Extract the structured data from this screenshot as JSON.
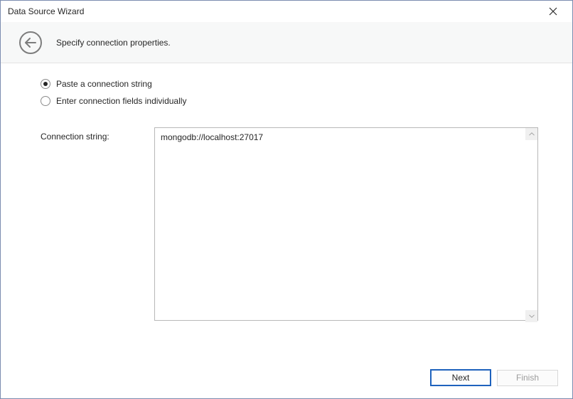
{
  "titlebar": {
    "title": "Data Source Wizard"
  },
  "header": {
    "subtitle": "Specify connection properties."
  },
  "options": {
    "paste_label": "Paste a connection string",
    "fields_label": "Enter connection fields individually",
    "selected": "paste"
  },
  "form": {
    "connection_string_label": "Connection string:",
    "connection_string_value": "mongodb://localhost:27017"
  },
  "footer": {
    "next_label": "Next",
    "finish_label": "Finish"
  }
}
